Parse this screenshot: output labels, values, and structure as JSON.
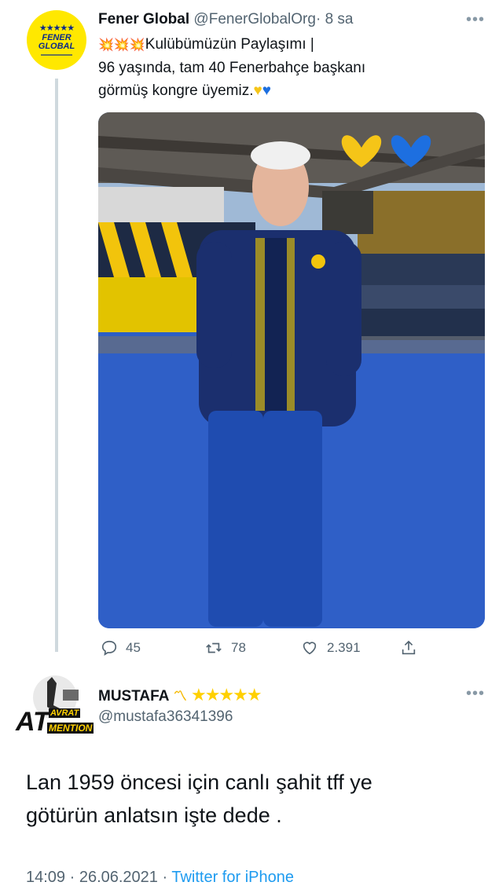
{
  "tweet": {
    "author_name": "Fener Global",
    "author_handle": "@FenerGlobalOrg",
    "separator": "·",
    "time": "8 sa",
    "avatar_text_line1": "FENER",
    "avatar_text_line2": "GLOBAL",
    "avatar_stars": "★★★★★",
    "text_line1": "Kulübümüzün Paylaşımı |",
    "text_line2": "96 yaşında, tam 40 Fenerbahçe başkanı",
    "text_line3": "görmüş kongre üyemiz.",
    "sparkle_emoji": "💥",
    "heart_yellow": "♥",
    "heart_blue": "♥",
    "more_icon": "•••",
    "reply_count": "45",
    "retweet_count": "78",
    "like_count": "2.391"
  },
  "reply": {
    "author_name": "MUSTAFA",
    "author_handle": "@mustafa36341396",
    "text_line1": "Lan 1959 öncesi için canlı şahit tff ye",
    "text_line2": "götürün anlatsın işte dede .",
    "avatar_text_main": "AT",
    "avatar_text_top": "AVRAT",
    "avatar_text_bottom": "MENTION",
    "name_stars": "★★★★★",
    "more_icon": "•••",
    "timestamp": "14:09 · 26.06.2021 ·",
    "source": "Twitter for iPhone"
  },
  "colors": {
    "accent": "#1d9bf0",
    "muted": "#536471",
    "fenerbahce_yellow": "#ffe800",
    "fenerbahce_navy": "#0b2a8a"
  }
}
